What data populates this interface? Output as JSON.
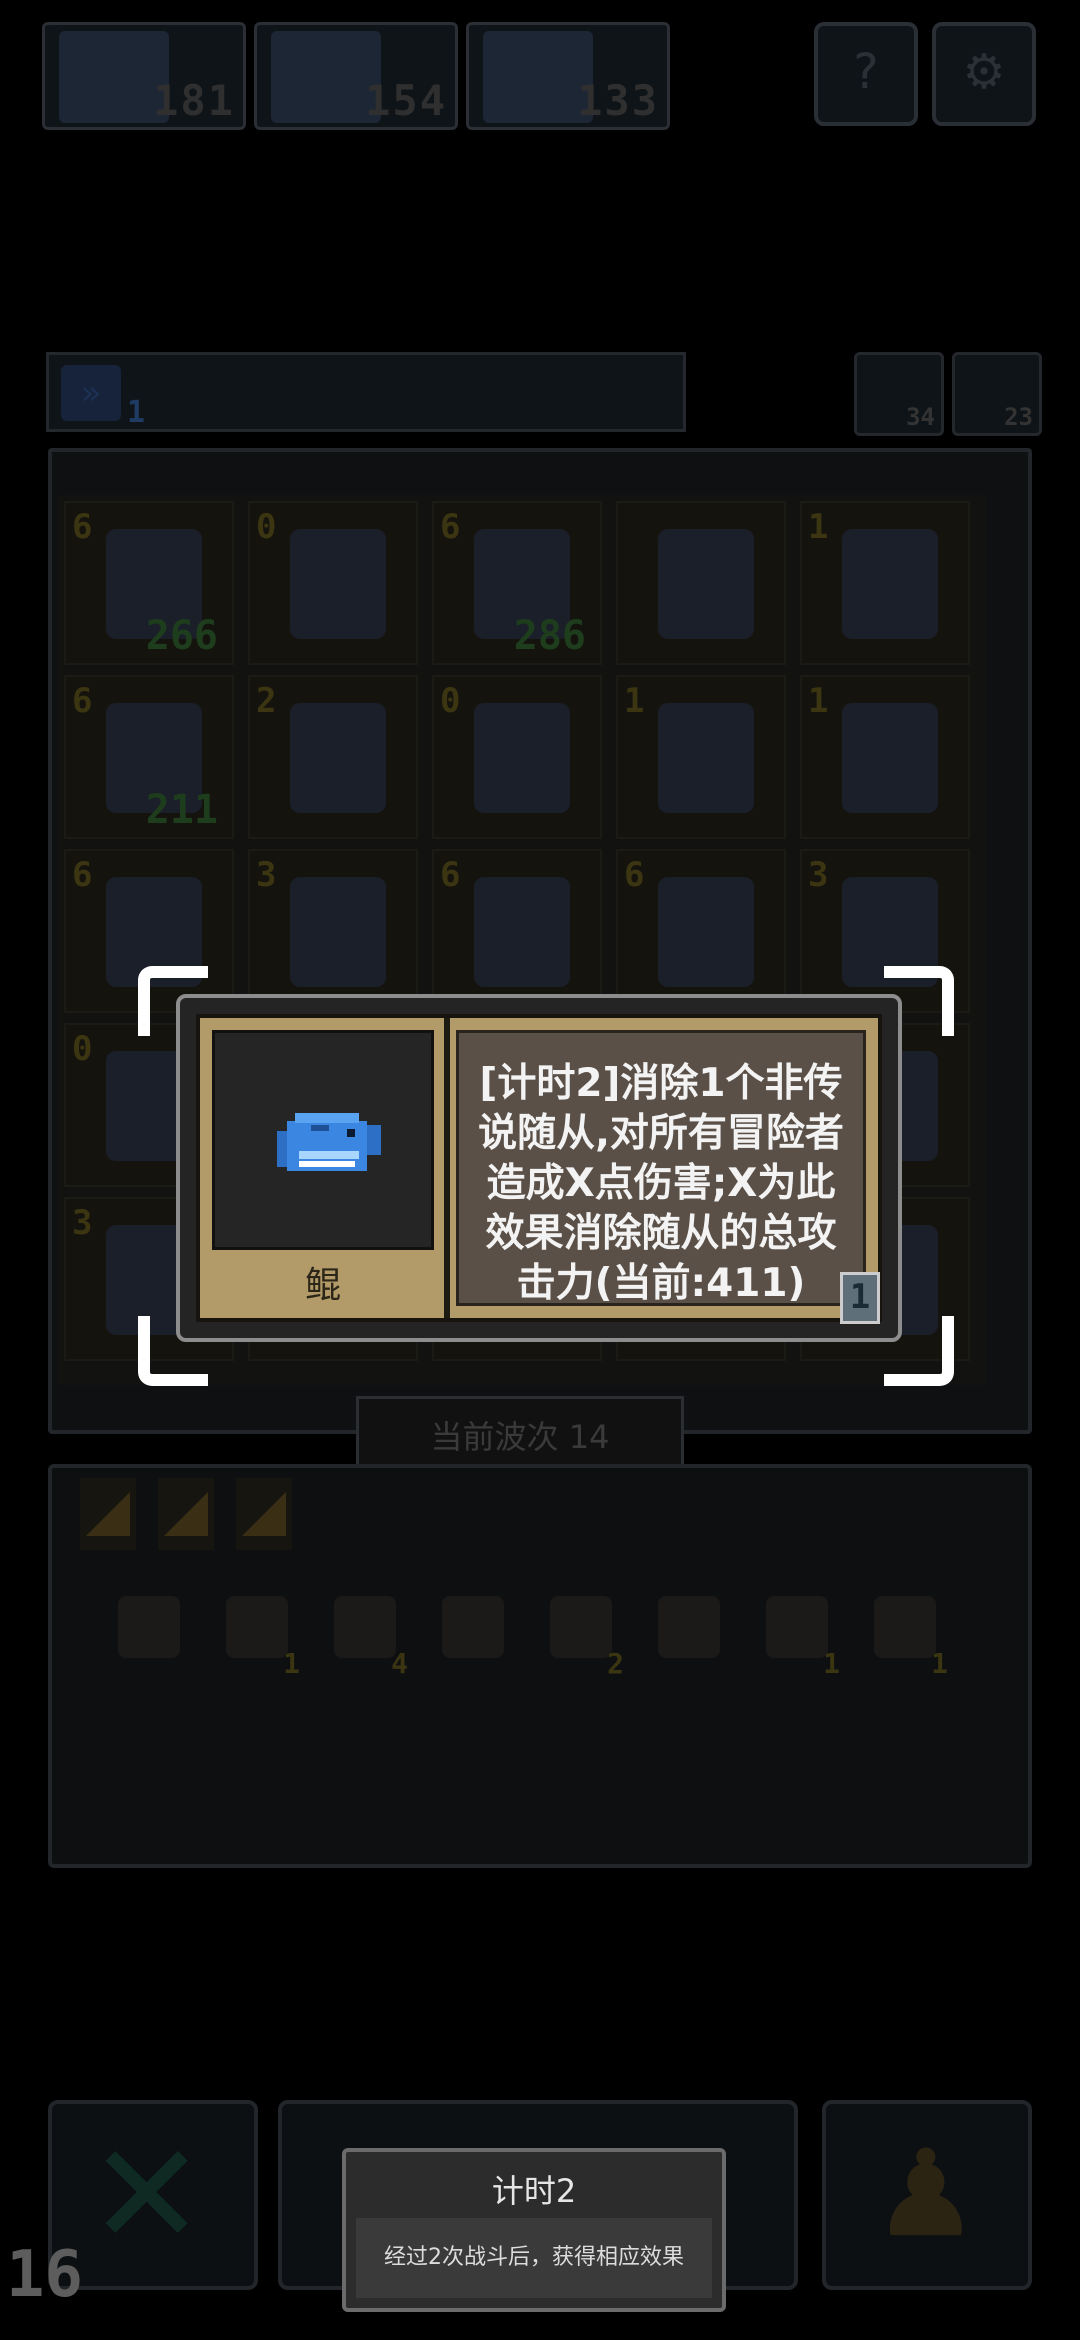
{
  "party": [
    {
      "count": "181"
    },
    {
      "count": "154"
    },
    {
      "count": "133"
    }
  ],
  "top_buttons": [
    {
      "icon": "question-icon",
      "glyph": "?"
    },
    {
      "icon": "gear-icon",
      "glyph": "⚙"
    }
  ],
  "info_strip": {
    "icon": "fast-forward-icon",
    "glyph": "»",
    "value": "1"
  },
  "mini_stats": [
    {
      "icon": "recycle-icon",
      "value": "34"
    },
    {
      "icon": "trophy-icon",
      "value": "23"
    }
  ],
  "board": {
    "rows": [
      [
        {
          "lvl": "6",
          "atk": "266"
        },
        {
          "lvl": "0",
          "atk": ""
        },
        {
          "lvl": "6",
          "atk": "286"
        },
        {
          "lvl": "",
          "atk": ""
        },
        {
          "lvl": "1",
          "atk": ""
        }
      ],
      [
        {
          "lvl": "6",
          "atk": "211"
        },
        {
          "lvl": "2",
          "atk": ""
        },
        {
          "lvl": "0",
          "atk": ""
        },
        {
          "lvl": "1",
          "atk": ""
        },
        {
          "lvl": "1",
          "atk": ""
        }
      ],
      [
        {
          "lvl": "6",
          "atk": ""
        },
        {
          "lvl": "3",
          "atk": ""
        },
        {
          "lvl": "6",
          "atk": ""
        },
        {
          "lvl": "6",
          "atk": ""
        },
        {
          "lvl": "3",
          "atk": ""
        }
      ],
      [
        {
          "lvl": "0",
          "atk": ""
        },
        {
          "lvl": "",
          "atk": ""
        },
        {
          "lvl": "",
          "atk": ""
        },
        {
          "lvl": "",
          "atk": ""
        },
        {
          "lvl": "",
          "atk": ""
        }
      ],
      [
        {
          "lvl": "3",
          "atk": ""
        },
        {
          "lvl": "",
          "atk": ""
        },
        {
          "lvl": "",
          "atk": ""
        },
        {
          "lvl": "",
          "atk": ""
        },
        {
          "lvl": "",
          "atk": ""
        }
      ]
    ]
  },
  "wave_label": "当前波次 14",
  "inventory": {
    "items": [
      {
        "icon": "hammer-icon",
        "count": ""
      },
      {
        "icon": "barrel-icon",
        "count": "1"
      },
      {
        "icon": "wand-icon",
        "count": "4"
      },
      {
        "icon": "dinosaur-icon",
        "count": ""
      },
      {
        "icon": "crate-icon",
        "count": "2"
      },
      {
        "icon": "trap-icon",
        "count": ""
      },
      {
        "icon": "crystal-icon",
        "count": "1"
      },
      {
        "icon": "whale-icon",
        "count": "1"
      }
    ]
  },
  "card": {
    "name": "鲲",
    "icon": "whale-icon",
    "description": "[计时2]消除1个非传说随从,对所有冒险者造成X点伤害;X为此效果消除随从的总攻击力(当前:411)",
    "count": "1"
  },
  "toast": {
    "title": "计时2",
    "body": "经过2次战斗后，获得相应效果"
  },
  "bottom": {
    "turn": "16",
    "cancel_icon": "close-icon",
    "pawn_icon": "pawn-icon"
  },
  "colors": {
    "card_frame": "#b39b69",
    "desc_bg": "#5b5048",
    "background": "#000000"
  }
}
